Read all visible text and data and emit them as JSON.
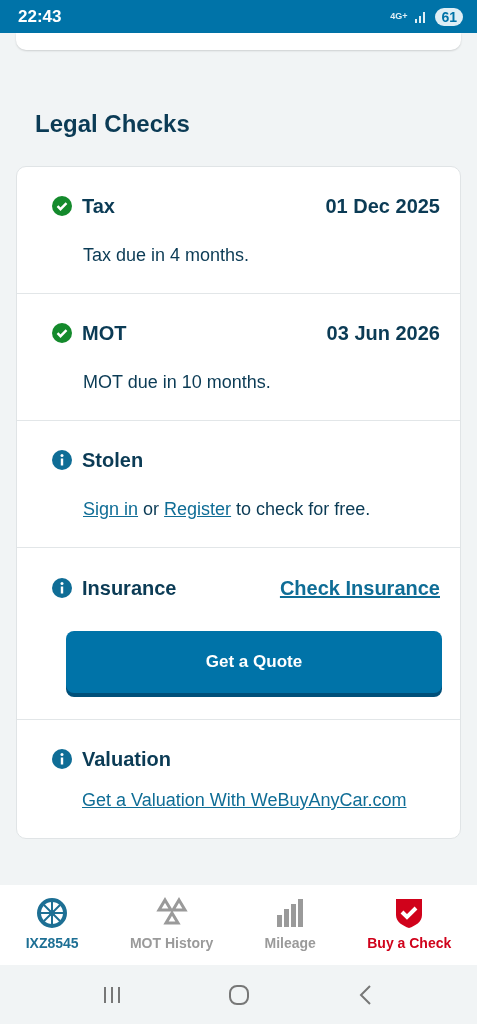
{
  "status_bar": {
    "time": "22:43",
    "network": "4G+",
    "battery": "61"
  },
  "section_title": "Legal Checks",
  "rows": [
    {
      "kind": "dated",
      "title": "Tax",
      "date": "01 Dec 2025",
      "note": "Tax due in 4 months."
    },
    {
      "kind": "dated",
      "title": "MOT",
      "date": "03 Jun 2026",
      "note": "MOT due in 10 months."
    },
    {
      "kind": "sentence",
      "title": "Stolen",
      "parts": [
        {
          "kind": "link",
          "text": "Sign in"
        },
        {
          "kind": "plain",
          "text": " or "
        },
        {
          "kind": "link",
          "text": "Register"
        },
        {
          "kind": "plain",
          "text": " to check for free."
        }
      ]
    },
    {
      "kind": "quote",
      "title": "Insurance",
      "link": "Check Insurance",
      "button": "Get a Quote"
    },
    {
      "kind": "link",
      "title": "Valuation",
      "link": "Get a Valuation With WeBuyAnyCar.com"
    }
  ],
  "bottom_nav": [
    {
      "label": "IXZ8545",
      "color": "#1d6f94"
    },
    {
      "label": "MOT History",
      "color": "#9a9a9a"
    },
    {
      "label": "Mileage",
      "color": "#9a9a9a"
    },
    {
      "label": "Buy a Check",
      "color": "#d0021b"
    }
  ]
}
